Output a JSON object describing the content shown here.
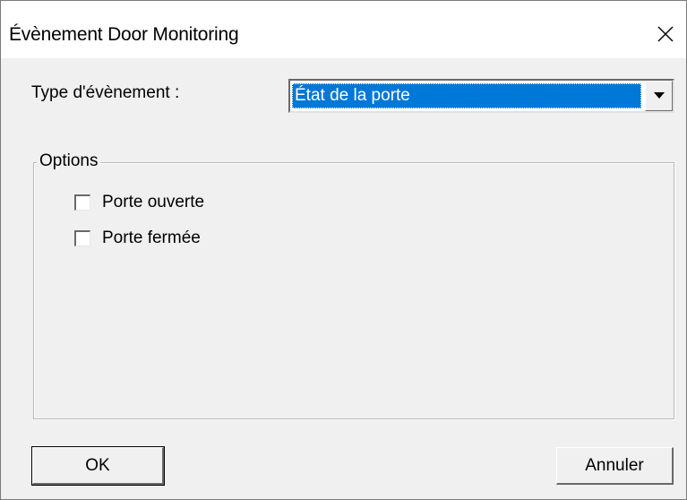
{
  "window": {
    "title": "Évènement Door Monitoring",
    "close_icon": "close-icon"
  },
  "form": {
    "event_type_label": "Type d'évènement :",
    "event_type_value": "État de la porte"
  },
  "options": {
    "legend": "Options",
    "items": [
      {
        "label": "Porte ouverte",
        "checked": false
      },
      {
        "label": "Porte fermée",
        "checked": false
      }
    ]
  },
  "buttons": {
    "ok": "OK",
    "cancel": "Annuler"
  }
}
